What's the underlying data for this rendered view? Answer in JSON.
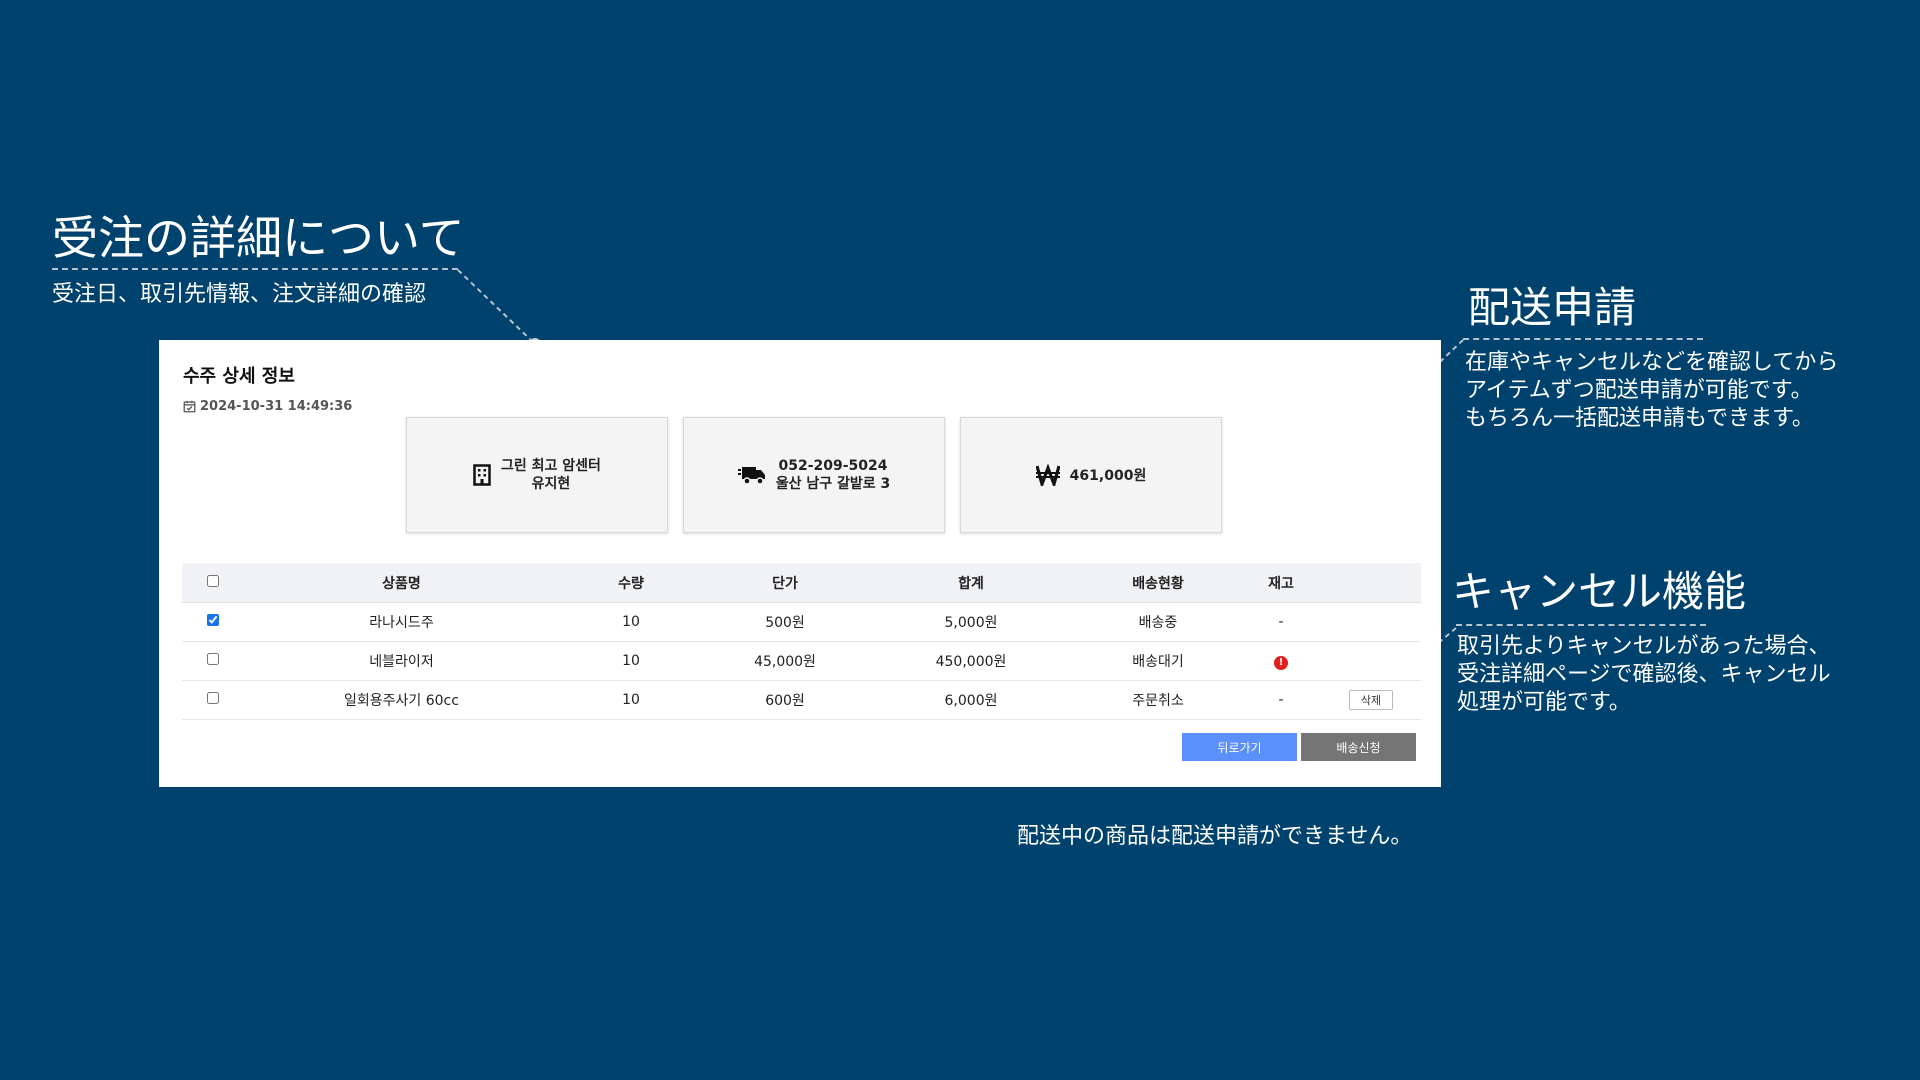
{
  "annotations": {
    "order_detail": {
      "title": "受注の詳細について",
      "desc": "受注日、取引先情報、注文詳細の確認"
    },
    "shipping_request": {
      "title": "配送申請",
      "desc": [
        "在庫やキャンセルなどを確認してから",
        "アイテムずつ配送申請が可能です。",
        "もちろん一括配送申請もできます。"
      ]
    },
    "cancel_feature": {
      "title": "キャンセル機能",
      "desc": [
        "取引先よりキャンセルがあった場合、",
        "受注詳細ページで確認後、キャンセル",
        "処理が可能です。"
      ]
    },
    "footnote": "配送中の商品は配送申請ができません。"
  },
  "panel": {
    "title": "수주 상세 정보",
    "date": "2024-10-31 14:49:36"
  },
  "cards": {
    "client": {
      "line1": "그린 최고 암센터",
      "line2": "유지현"
    },
    "delivery": {
      "line1": "052-209-5024",
      "line2": "울산 남구 갈밭로 3"
    },
    "amount": {
      "value": "461,000원"
    }
  },
  "table": {
    "headers": [
      "상품명",
      "수량",
      "단가",
      "합계",
      "배송현황",
      "재고"
    ],
    "rows": [
      {
        "checked": true,
        "name": "라나시드주",
        "qty": "10",
        "unit": "500원",
        "total": "5,000원",
        "status": "배송중",
        "stock": "-",
        "action": ""
      },
      {
        "checked": false,
        "name": "네블라이저",
        "qty": "10",
        "unit": "45,000원",
        "total": "450,000원",
        "status": "배송대기",
        "stock": "!",
        "action": ""
      },
      {
        "checked": false,
        "name": "일회용주사기 60cc",
        "qty": "10",
        "unit": "600원",
        "total": "6,000원",
        "status": "주문취소",
        "stock": "-",
        "action": "삭제"
      }
    ]
  },
  "buttons": {
    "back": "뒤로가기",
    "ship": "배송신청"
  },
  "colors": {
    "background": "#00426e",
    "primary_button": "#5b8ff9",
    "secondary_button": "#757575",
    "alert": "#e0201b"
  },
  "icons": {
    "date": "calendar-check-icon",
    "client": "building-icon",
    "delivery": "truck-icon",
    "amount": "won-icon",
    "stock_alert": "alert-icon"
  }
}
